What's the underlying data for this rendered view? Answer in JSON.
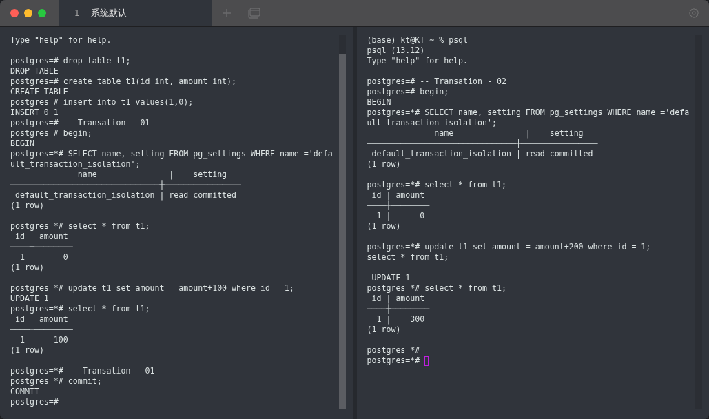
{
  "tabs": [
    {
      "number": "1",
      "label": "系统默认",
      "selected": true
    }
  ],
  "panes": [
    {
      "cursor": false,
      "blocks": [
        [
          "Type \"help\" for help."
        ],
        [
          "postgres=# drop table t1;",
          "DROP TABLE",
          "postgres=# create table t1(id int, amount int);",
          "CREATE TABLE",
          "postgres=# insert into t1 values(1,0);",
          "INSERT 0 1",
          "postgres=# -- Transation - 01",
          "postgres=# begin;",
          "BEGIN",
          "postgres=*# SELECT name, setting FROM pg_settings WHERE name ='defa",
          "ult_transaction_isolation';",
          "              name               |    setting",
          "───────────────────────────────┼────────────────",
          " default_transaction_isolation | read committed",
          "(1 row)"
        ],
        [
          "postgres=*# select * from t1;",
          " id | amount",
          "────┼────────",
          "  1 |      0",
          "(1 row)"
        ],
        [
          "postgres=*# update t1 set amount = amount+100 where id = 1;",
          "UPDATE 1",
          "postgres=*# select * from t1;",
          " id | amount",
          "────┼────────",
          "  1 |    100",
          "(1 row)"
        ],
        [
          "postgres=*# -- Transation - 01",
          "postgres=*# commit;",
          "COMMIT",
          "postgres=#"
        ]
      ]
    },
    {
      "cursor": true,
      "blocks": [
        [
          "(base) kt@KT ~ % psql",
          "psql (13.12)",
          "Type \"help\" for help."
        ],
        [
          "postgres=# -- Transation - 02",
          "postgres=# begin;",
          "BEGIN",
          "postgres=*# SELECT name, setting FROM pg_settings WHERE name ='defa",
          "ult_transaction_isolation';",
          "              name               |    setting",
          "───────────────────────────────┼────────────────",
          " default_transaction_isolation | read committed",
          "(1 row)"
        ],
        [
          "postgres=*# select * from t1;",
          " id | amount",
          "────┼────────",
          "  1 |      0",
          "(1 row)"
        ],
        [
          "postgres=*# update t1 set amount = amount+200 where id = 1;",
          "select * from t1;"
        ],
        [
          " UPDATE 1",
          "postgres=*# select * from t1;",
          " id | amount",
          "────┼────────",
          "  1 |    300",
          "(1 row)"
        ],
        [
          "postgres=*#",
          "postgres=*# "
        ]
      ]
    }
  ]
}
